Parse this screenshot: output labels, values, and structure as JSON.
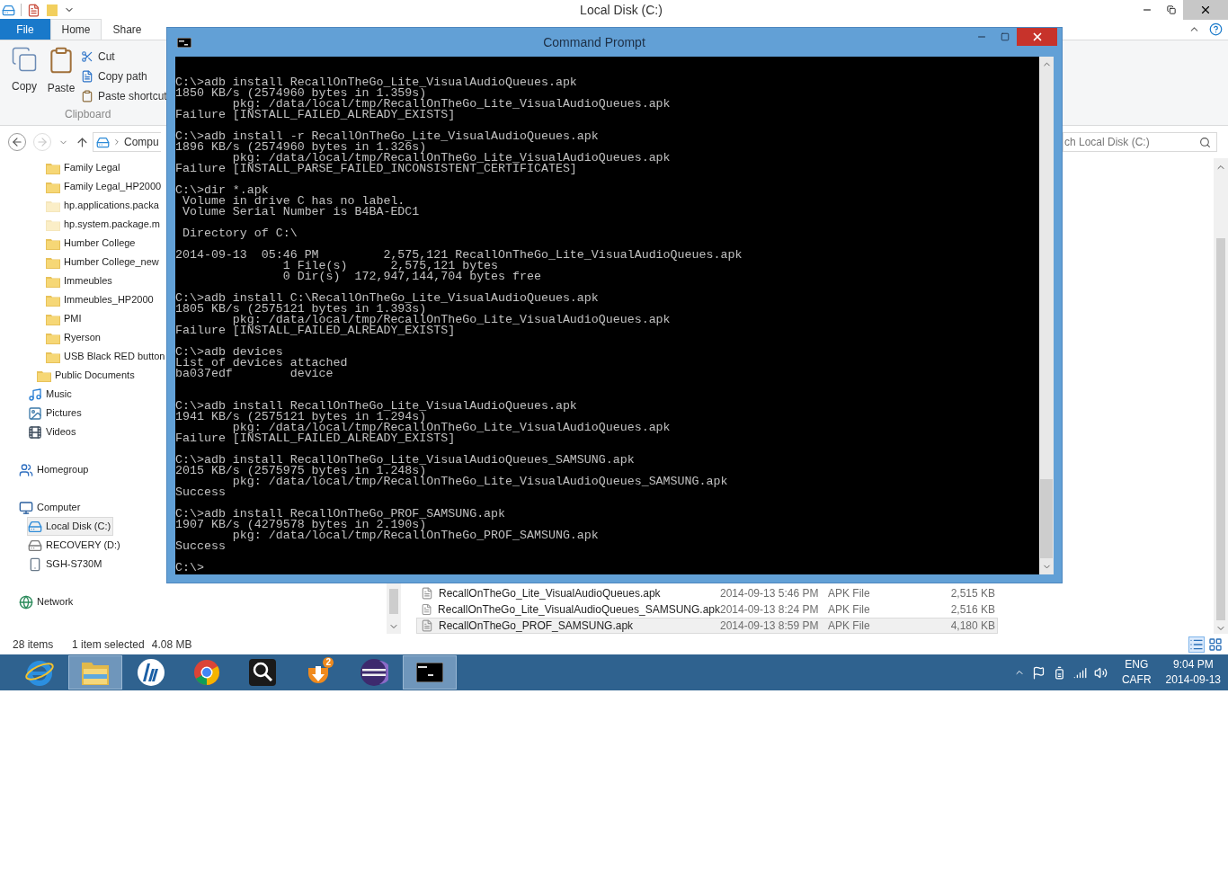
{
  "explorer": {
    "title": "Local Disk (C:)",
    "ribbon_tabs": [
      {
        "label": "File",
        "kind": "file",
        "selected": false
      },
      {
        "label": "Home",
        "kind": "tab",
        "selected": true
      },
      {
        "label": "Share",
        "kind": "tab",
        "selected": false
      }
    ],
    "clipboard": {
      "copy": "Copy",
      "paste": "Paste",
      "cut": "Cut",
      "copy_path": "Copy path",
      "paste_shortcut": "Paste shortcut",
      "group_label": "Clipboard"
    },
    "forward_disabled": true,
    "address": {
      "crumb": "Compu"
    },
    "search": {
      "placeholder": "ch Local Disk (C:)"
    },
    "nav_tree": [
      {
        "children": [
          {
            "children": [
              {
                "children": [
                  {
                    "label": "Family Legal",
                    "kind": "folder",
                    "hidden": false,
                    "selected": false
                  },
                  {
                    "label": "Family Legal_HP2000",
                    "kind": "folder",
                    "hidden": false,
                    "selected": false
                  },
                  {
                    "label": "hp.applications.packa",
                    "kind": "folder",
                    "hidden": true,
                    "selected": false
                  },
                  {
                    "label": "hp.system.package.m",
                    "kind": "folder",
                    "hidden": true,
                    "selected": false
                  },
                  {
                    "label": "Humber College",
                    "kind": "folder",
                    "hidden": false,
                    "selected": false
                  },
                  {
                    "label": "Humber College_new",
                    "kind": "folder",
                    "hidden": false,
                    "selected": false
                  },
                  {
                    "label": "Immeubles",
                    "kind": "folder",
                    "hidden": false,
                    "selected": false
                  },
                  {
                    "label": "Immeubles_HP2000",
                    "kind": "folder",
                    "hidden": false,
                    "selected": false
                  },
                  {
                    "label": "PMI",
                    "kind": "folder",
                    "hidden": false,
                    "selected": false
                  },
                  {
                    "label": "Ryerson",
                    "kind": "folder",
                    "hidden": false,
                    "selected": false
                  },
                  {
                    "label": "USB Black RED button",
                    "kind": "folder",
                    "hidden": false,
                    "selected": false
                  }
                ]
              },
              {
                "label": "Public Documents",
                "kind": "folder",
                "hidden": false,
                "selected": false
              }
            ]
          },
          {
            "label": "Music",
            "kind": "music",
            "hidden": false,
            "selected": false
          },
          {
            "label": "Pictures",
            "kind": "pictures",
            "hidden": false,
            "selected": false
          },
          {
            "label": "Videos",
            "kind": "videos",
            "hidden": false,
            "selected": false
          }
        ]
      },
      {
        "label": "Homegroup",
        "kind": "homegroup",
        "hidden": false,
        "selected": false
      },
      {
        "label": "Computer",
        "kind": "computer",
        "hidden": false,
        "selected": false,
        "children": [
          {
            "label": "Local Disk (C:)",
            "kind": "system_drive",
            "hidden": false,
            "selected": true
          },
          {
            "label": "RECOVERY (D:)",
            "kind": "drive",
            "hidden": false,
            "selected": false
          },
          {
            "label": "SGH-S730M",
            "kind": "phone",
            "hidden": false,
            "selected": false
          }
        ]
      },
      {
        "label": "Network",
        "kind": "network",
        "hidden": false,
        "selected": false
      }
    ],
    "files": [
      {
        "name": "RecallOnTheGo_Lite_VisualAudioQueues.apk",
        "date": "2014-09-13 5:46 PM",
        "type": "APK File",
        "size": "2,515 KB",
        "selected": false
      },
      {
        "name": "RecallOnTheGo_Lite_VisualAudioQueues_SAMSUNG.apk",
        "date": "2014-09-13 8:24 PM",
        "type": "APK File",
        "size": "2,516 KB",
        "selected": false
      },
      {
        "name": "RecallOnTheGo_PROF_SAMSUNG.apk",
        "date": "2014-09-13 8:59 PM",
        "type": "APK File",
        "size": "4,180 KB",
        "selected": true
      }
    ],
    "status": {
      "count": "28 items",
      "selection": "1 item selected",
      "size": "4.08 MB"
    }
  },
  "console_window": {
    "title": "Command Prompt",
    "output": "C:\\>adb install RecallOnTheGo_Lite_VisualAudioQueues.apk\n1850 KB/s (2574960 bytes in 1.359s)\n        pkg: /data/local/tmp/RecallOnTheGo_Lite_VisualAudioQueues.apk\nFailure [INSTALL_FAILED_ALREADY_EXISTS]\n\nC:\\>adb install -r RecallOnTheGo_Lite_VisualAudioQueues.apk\n1896 KB/s (2574960 bytes in 1.326s)\n        pkg: /data/local/tmp/RecallOnTheGo_Lite_VisualAudioQueues.apk\nFailure [INSTALL_PARSE_FAILED_INCONSISTENT_CERTIFICATES]\n\nC:\\>dir *.apk\n Volume in drive C has no label.\n Volume Serial Number is B4BA-EDC1\n\n Directory of C:\\\n\n2014-09-13  05:46 PM         2,575,121 RecallOnTheGo_Lite_VisualAudioQueues.apk\n               1 File(s)      2,575,121 bytes\n               0 Dir(s)  172,947,144,704 bytes free\n\nC:\\>adb install C:\\RecallOnTheGo_Lite_VisualAudioQueues.apk\n1805 KB/s (2575121 bytes in 1.393s)\n        pkg: /data/local/tmp/RecallOnTheGo_Lite_VisualAudioQueues.apk\nFailure [INSTALL_FAILED_ALREADY_EXISTS]\n\nC:\\>adb devices\nList of devices attached\nba037edf        device\n\n\nC:\\>adb install RecallOnTheGo_Lite_VisualAudioQueues.apk\n1941 KB/s (2575121 bytes in 1.294s)\n        pkg: /data/local/tmp/RecallOnTheGo_Lite_VisualAudioQueues.apk\nFailure [INSTALL_FAILED_ALREADY_EXISTS]\n\nC:\\>adb install RecallOnTheGo_Lite_VisualAudioQueues_SAMSUNG.apk\n2015 KB/s (2575975 bytes in 1.248s)\n        pkg: /data/local/tmp/RecallOnTheGo_Lite_VisualAudioQueues_SAMSUNG.apk\nSuccess\n\nC:\\>adb install RecallOnTheGo_PROF_SAMSUNG.apk\n1907 KB/s (4279578 bytes in 2.190s)\n        pkg: /data/local/tmp/RecallOnTheGo_PROF_SAMSUNG.apk\nSuccess\n\nC:\\>"
  },
  "taskbar": {
    "apps": [
      {
        "kind": "browser",
        "active": false
      },
      {
        "kind": "explorer",
        "active": true
      },
      {
        "kind": "hp",
        "active": false
      },
      {
        "kind": "chrome",
        "active": false
      },
      {
        "kind": "magnifier",
        "active": false
      },
      {
        "kind": "updater",
        "active": false,
        "badge": "2"
      },
      {
        "kind": "eclipse",
        "active": false
      },
      {
        "kind": "console",
        "active": true
      }
    ],
    "language": "ENG",
    "layout": "CAFR",
    "time": "9:04 PM",
    "date": "2014-09-13"
  }
}
